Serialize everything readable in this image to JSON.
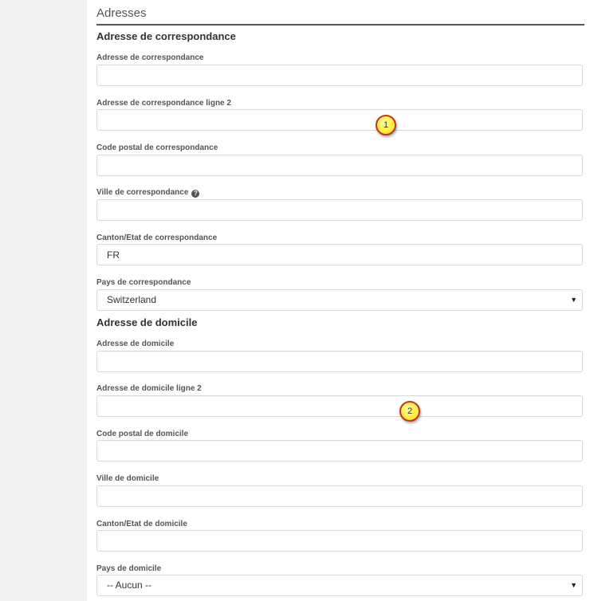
{
  "section": {
    "title": "Adresses"
  },
  "correspondence": {
    "heading": "Adresse de correspondance",
    "address_label": "Adresse de correspondance",
    "address_value": "",
    "address2_label": "Adresse de correspondance ligne 2",
    "address2_value": "",
    "postal_label": "Code postal de correspondance",
    "postal_value": "",
    "city_label": "Ville de correspondance",
    "city_value": "",
    "canton_label": "Canton/Etat de correspondance",
    "canton_value": "FR",
    "country_label": "Pays de correspondance",
    "country_value": "Switzerland"
  },
  "domicile": {
    "heading": "Adresse de domicile",
    "address_label": "Adresse de domicile",
    "address_value": "",
    "address2_label": "Adresse de domicile ligne 2",
    "address2_value": "",
    "postal_label": "Code postal de domicile",
    "postal_value": "",
    "city_label": "Ville de domicile",
    "city_value": "",
    "canton_label": "Canton/Etat de domicile",
    "canton_value": "",
    "country_label": "Pays de domicile",
    "country_value": "-- Aucun --"
  },
  "icons": {
    "help": "question-circle-icon",
    "dropdown": "caret-down-icon"
  },
  "glyphs": {
    "help": "?",
    "caret": "▼"
  },
  "callouts": {
    "first": "1",
    "second": "2"
  },
  "colors": {
    "badge_fill": "#ffef3a",
    "badge_border": "#c4311c"
  }
}
